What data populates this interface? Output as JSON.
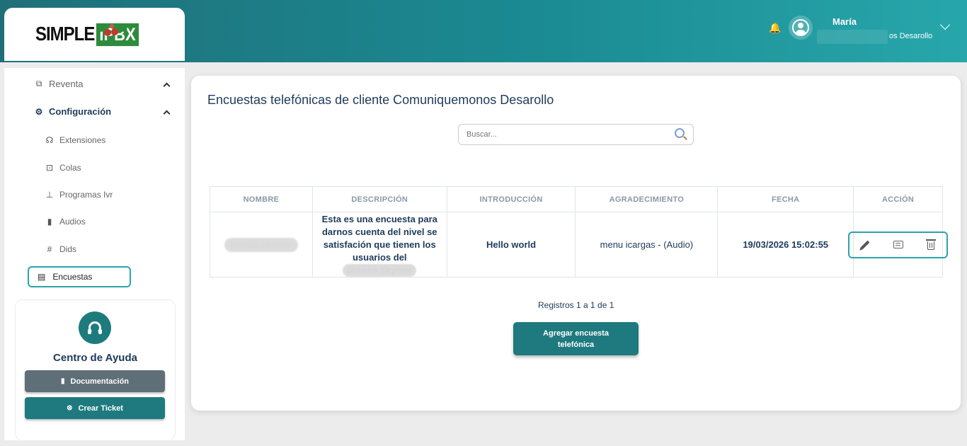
{
  "header": {
    "user_name": "María",
    "user_company": "os Desarollo"
  },
  "logo": {
    "word1": "SIMPLE",
    "word2": "IPBX"
  },
  "sidebar": {
    "items": [
      {
        "label": "Reventa",
        "icon": "resale-icon"
      },
      {
        "label": "Configuración",
        "icon": "gear-icon"
      },
      {
        "label": "Extensiones",
        "icon": "headset-icon"
      },
      {
        "label": "Colas",
        "icon": "queue-icon"
      },
      {
        "label": "Programas Ivr",
        "icon": "sitemap-icon"
      },
      {
        "label": "Audios",
        "icon": "audio-file-icon"
      },
      {
        "label": "Dids",
        "icon": "hash-icon"
      },
      {
        "label": "Encuestas",
        "icon": "survey-icon"
      }
    ]
  },
  "help": {
    "title": "Centro de Ayuda",
    "doc_label": "Documentación",
    "ticket_label": "Crear Ticket"
  },
  "main": {
    "title": "Encuestas telefónicas de cliente Comuniquemonos Desarollo",
    "search_placeholder": "Buscar...",
    "columns": [
      "NOMBRE",
      "DESCRIPCIÓN",
      "INTRODUCCIÓN",
      "AGRADECIMIENTO",
      "FECHA",
      "ACCIÓN"
    ],
    "rows": [
      {
        "nombre": "Nissan Skyline",
        "descripcion": "Esta es una encuesta para darnos cuenta del nivel se satisfación que tienen los usuarios del",
        "descripcion_tail": "Nissan Skyline",
        "introduccion": "Hello world",
        "agradecimiento": "menu icargas - (Audio)",
        "fecha": "19/03/2026 15:02:55"
      }
    ],
    "records_text": "Registros 1 a 1 de 1",
    "add_button": "Agregar encuesta telefónica"
  }
}
